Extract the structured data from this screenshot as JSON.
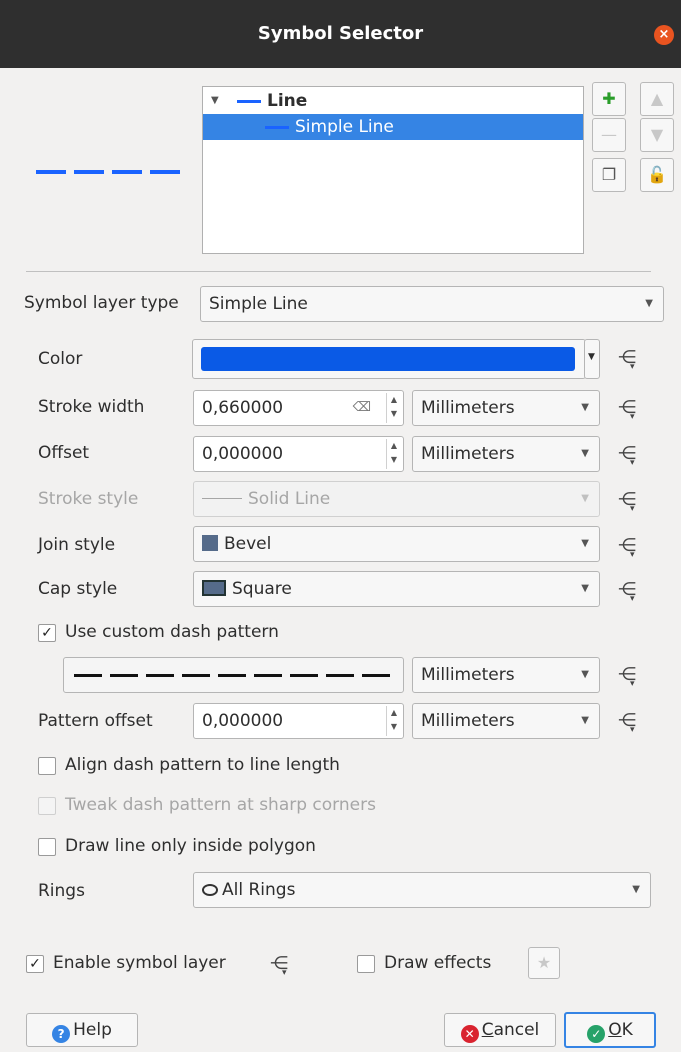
{
  "window": {
    "title": "Symbol Selector",
    "close_icon": "×"
  },
  "tree": {
    "root_label": "Line",
    "child_label": "Simple Line"
  },
  "symbol_layer_type": {
    "label": "Symbol layer type",
    "value": "Simple Line"
  },
  "color": {
    "label": "Color",
    "value": "#0a5ae6"
  },
  "stroke_width": {
    "label": "Stroke width",
    "value": "0,660000",
    "unit": "Millimeters"
  },
  "offset": {
    "label": "Offset",
    "value": "0,000000",
    "unit": "Millimeters"
  },
  "stroke_style": {
    "label": "Stroke style",
    "value": "Solid Line"
  },
  "join_style": {
    "label": "Join style",
    "value": "Bevel"
  },
  "cap_style": {
    "label": "Cap style",
    "value": "Square"
  },
  "custom_dash": {
    "label": "Use custom dash pattern",
    "checked": true,
    "unit": "Millimeters"
  },
  "pattern_offset": {
    "label": "Pattern offset",
    "value": "0,000000",
    "unit": "Millimeters"
  },
  "align_dash": {
    "label": "Align dash pattern to line length",
    "checked": false
  },
  "tweak_dash": {
    "label": "Tweak dash pattern at sharp corners",
    "checked": false
  },
  "draw_inside": {
    "label": "Draw line only inside polygon",
    "checked": false
  },
  "rings": {
    "label": "Rings",
    "value": "All Rings"
  },
  "enable_layer": {
    "label": "Enable symbol layer",
    "checked": true
  },
  "draw_effects": {
    "label": "Draw effects",
    "checked": false
  },
  "buttons": {
    "help": "Help",
    "cancel_prefix": "",
    "cancel_underlined": "C",
    "cancel_rest": "ancel",
    "ok_underlined": "O",
    "ok_rest": "K"
  },
  "check_mark": "✓"
}
